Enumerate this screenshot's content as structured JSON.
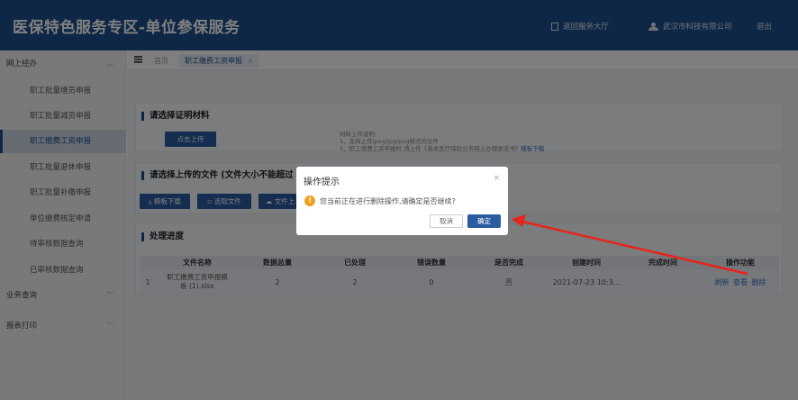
{
  "header": {
    "title": "医保特色服务专区-单位参保服务",
    "back_link": "返回服务大厅",
    "company": "武汉市科技有限公司",
    "logout": "退出"
  },
  "sidebar": {
    "group_online": "网上经办",
    "items": [
      {
        "label": "职工批量增员申报"
      },
      {
        "label": "职工批量减员申报"
      },
      {
        "label": "职工缴费工资申报",
        "active": true
      },
      {
        "label": "职工批量退休申报"
      },
      {
        "label": "职工批量补缴申报"
      },
      {
        "label": "单位缴费核定申请"
      },
      {
        "label": "待审核数据查询"
      },
      {
        "label": "已审核数据查询"
      }
    ],
    "group_query": "业务查询",
    "group_print": "报表打印"
  },
  "tabs": {
    "home": "首页",
    "current": "职工缴费工资申报",
    "close": "×"
  },
  "section1": {
    "title": "请选择证明材料",
    "upload_btn": "点击上传",
    "note_title": "材料上传说明:",
    "note_line1": "1、支持上传jpeg/jpg/png格式的文件",
    "note_line2": "2、职工缴费工资申报时,请上传《基本医疗保险业务网上办理承诺书》",
    "note_link": "模板下载"
  },
  "section2": {
    "title": "请选择上传的文件 (文件大小不能超过 10",
    "btn_template": "模板下载",
    "btn_choose": "选取文件",
    "btn_upload": "文件上"
  },
  "section3": {
    "title": "处理进度",
    "columns": [
      "",
      "文件名称",
      "数据总量",
      "已处理",
      "错误数量",
      "是否完成",
      "创建时间",
      "完成时间",
      "操作功能"
    ],
    "rows": [
      {
        "index": "1",
        "file_line1": "职工缴费工资申报模",
        "file_line2": "板 (1).xlsx",
        "total": "2",
        "processed": "2",
        "errors": "0",
        "done": "否",
        "created": "2021-07-23 10:3...",
        "finished": "",
        "op_refresh": "刷新",
        "op_view": "查看",
        "op_delete": "删除"
      }
    ]
  },
  "dialog": {
    "title": "操作提示",
    "close": "×",
    "message": "您当前正在进行删除操作,请确定是否继续?",
    "cancel": "取消",
    "confirm": "确定"
  },
  "colors": {
    "header_bg": "#1f4f8e",
    "primary": "#2a5aa0",
    "warning": "#f0a020",
    "annotation_arrow": "#e8231b"
  }
}
